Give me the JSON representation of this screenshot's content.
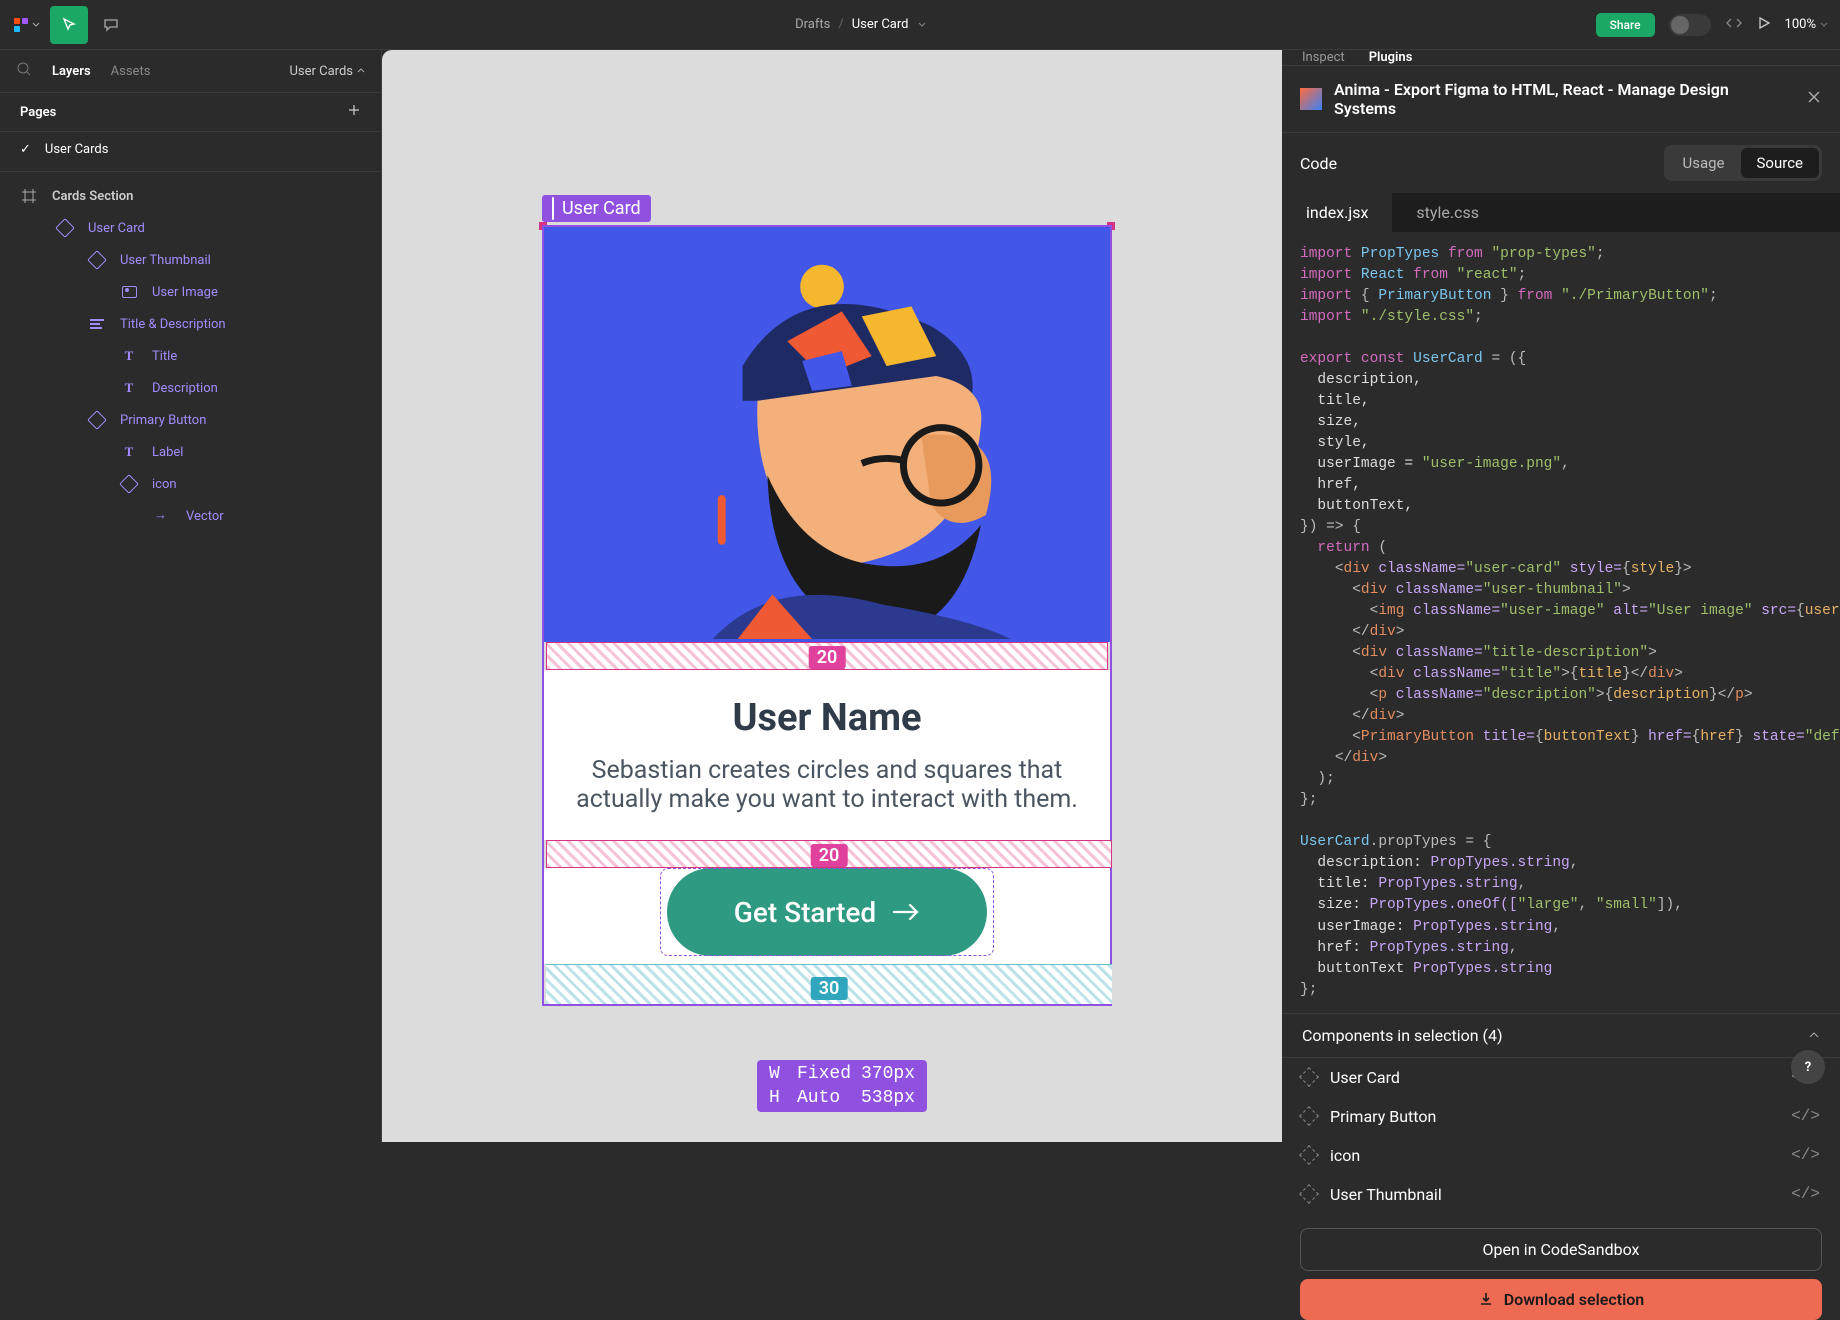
{
  "topbar": {
    "breadcrumb_root": "Drafts",
    "breadcrumb_current": "User Card",
    "share": "Share",
    "zoom": "100%"
  },
  "left_panel": {
    "tab_layers": "Layers",
    "tab_assets": "Assets",
    "component_dropdown": "User Cards",
    "pages_label": "Pages",
    "page_current": "User Cards",
    "root_frame": "Cards Section",
    "tree": [
      {
        "l": 1,
        "icon": "diamond",
        "label": "User Card"
      },
      {
        "l": 2,
        "icon": "diamond",
        "label": "User Thumbnail"
      },
      {
        "l": 3,
        "icon": "image",
        "label": "User Image"
      },
      {
        "l": 2,
        "icon": "align",
        "label": "Title & Description"
      },
      {
        "l": 3,
        "icon": "text",
        "label": "Title"
      },
      {
        "l": 3,
        "icon": "text",
        "label": "Description"
      },
      {
        "l": 2,
        "icon": "diamond",
        "label": "Primary Button"
      },
      {
        "l": 3,
        "icon": "text",
        "label": "Label"
      },
      {
        "l": 3,
        "icon": "diamond",
        "label": "icon"
      },
      {
        "l": 4,
        "icon": "arrow",
        "label": "Vector"
      }
    ]
  },
  "canvas": {
    "frame_label": "User Card",
    "user_name": "User Name",
    "description": "Sebastian creates circles and squares that actually make you want to interact with them.",
    "button_label": "Get Started",
    "gap_top": "20",
    "gap_mid": "20",
    "gap_bottom": "30",
    "size": {
      "wk": "W",
      "wm": "Fixed",
      "wv": "370px",
      "hk": "H",
      "hm": "Auto",
      "hv": "538px"
    }
  },
  "right_panel": {
    "tab_inspect": "Inspect",
    "tab_plugins": "Plugins",
    "plugin_title": "Anima - Export Figma to HTML, React - Manage Design Systems",
    "code_label": "Code",
    "seg_usage": "Usage",
    "seg_source": "Source",
    "file_jsx": "index.jsx",
    "file_css": "style.css",
    "components_header": "Components in selection (4)",
    "components": [
      "User Card",
      "Primary Button",
      "icon",
      "User Thumbnail"
    ],
    "open_sandbox": "Open in CodeSandbox",
    "download": "Download selection"
  },
  "code": {
    "l1a": "import",
    "l1b": "PropTypes",
    "l1c": "from",
    "l1d": "\"prop-types\"",
    "l1e": ";",
    "l2a": "import",
    "l2b": "React",
    "l2c": "from",
    "l2d": "\"react\"",
    "l2e": ";",
    "l3a": "import",
    "l3b": "{ ",
    "l3c": "PrimaryButton",
    "l3d": " }",
    "l3e": "from",
    "l3f": "\"./PrimaryButton\"",
    "l3g": ";",
    "l4a": "import",
    "l4b": "\"./style.css\"",
    "l4c": ";",
    "l6a": "export const",
    "l6b": "UserCard",
    "l6c": " = ({",
    "l7": "description,",
    "l8": "title,",
    "l9": "size,",
    "l10": "style,",
    "l11a": "userImage = ",
    "l11b": "\"user-image.png\"",
    "l11c": ",",
    "l12": "href,",
    "l13": "buttonText,",
    "l14": "}) => {",
    "l15a": "return",
    "l15b": " (",
    "l16a": "<",
    "l16b": "div",
    "l16c": " className=",
    "l16d": "\"user-card\"",
    "l16e": " style=",
    "l16f": "{",
    "l16g": "style",
    "l16h": "}>",
    "l17a": "<",
    "l17b": "div",
    "l17c": " className=",
    "l17d": "\"user-thumbnail\"",
    "l17e": ">",
    "l18a": "<",
    "l18b": "img",
    "l18c": " className=",
    "l18d": "\"user-image\"",
    "l18e": " alt=",
    "l18f": "\"User image\"",
    "l18g": " src=",
    "l18h": "{",
    "l18i": "userImage",
    "l18j": "} />",
    "l19a": "</",
    "l19b": "div",
    "l19c": ">",
    "l20a": "<",
    "l20b": "div",
    "l20c": " className=",
    "l20d": "\"title-description\"",
    "l20e": ">",
    "l21a": "<",
    "l21b": "div",
    "l21c": " className=",
    "l21d": "\"title\"",
    "l21e": ">{",
    "l21f": "title",
    "l21g": "}</",
    "l21h": "div",
    "l21i": ">",
    "l22a": "<",
    "l22b": "p",
    "l22c": " className=",
    "l22d": "\"description\"",
    "l22e": ">{",
    "l22f": "description",
    "l22g": "}</",
    "l22h": "p",
    "l22i": ">",
    "l23a": "</",
    "l23b": "div",
    "l23c": ">",
    "l24a": "<",
    "l24b": "PrimaryButton",
    "l24c": " title=",
    "l24d": "{",
    "l24e": "buttonText",
    "l24f": "}",
    "l24g": " href=",
    "l24h": "{",
    "l24i": "href",
    "l24j": "}",
    "l24k": " state=",
    "l24l": "\"default\"",
    "l24m": " />",
    "l25a": "</",
    "l25b": "div",
    "l25c": ">",
    "l26": ");",
    "l27": "};",
    "l29a": "UserCard",
    "l29b": ".propTypes = {",
    "l30a": "description: ",
    "l30b": "PropTypes.string",
    "l30c": ",",
    "l31a": "title: ",
    "l31b": "PropTypes.string",
    "l31c": ",",
    "l32a": "size: ",
    "l32b": "PropTypes.oneOf([",
    "l32c": "\"large\"",
    "l32d": ", ",
    "l32e": "\"small\"",
    "l32f": "]),",
    "l33a": "userImage: ",
    "l33b": "PropTypes.string",
    "l33c": ",",
    "l34a": "href: ",
    "l34b": "PropTypes.string",
    "l34c": ",",
    "l35a": "buttonText ",
    "l35b": "PropTypes.string",
    "l36": "};"
  }
}
